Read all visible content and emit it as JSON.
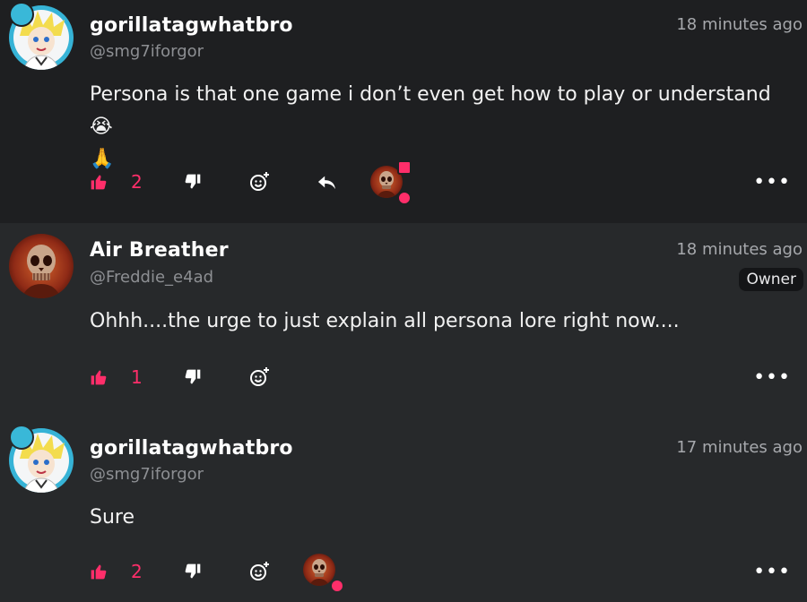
{
  "comments": [
    {
      "username": "gorillatagwhatbro",
      "handle": "@smg7iforgor",
      "time": "18 minutes ago",
      "text": "Persona is that one game i don’t even get how to play or understand 😭",
      "text_line2": "🙏",
      "like_count": "2",
      "avatar": "anime-character-avatar",
      "reacted_user_avatar": "skull-avatar"
    },
    {
      "username": "Air Breather",
      "handle": "@Freddie_e4ad",
      "time": "18 minutes ago",
      "role_badge": "Owner",
      "text": "Ohhh....the urge to just explain all persona lore right now....",
      "like_count": "1",
      "avatar": "skull-avatar"
    },
    {
      "username": "gorillatagwhatbro",
      "handle": "@smg7iforgor",
      "time": "17 minutes ago",
      "text": "Sure",
      "like_count": "2",
      "avatar": "anime-character-avatar",
      "reacted_user_avatar": "skull-avatar"
    }
  ],
  "ui": {
    "more_label": "•••"
  },
  "colors": {
    "accent": "#ff2e6a",
    "bg_highlight": "#1e1f21",
    "bg": "#27292b"
  }
}
